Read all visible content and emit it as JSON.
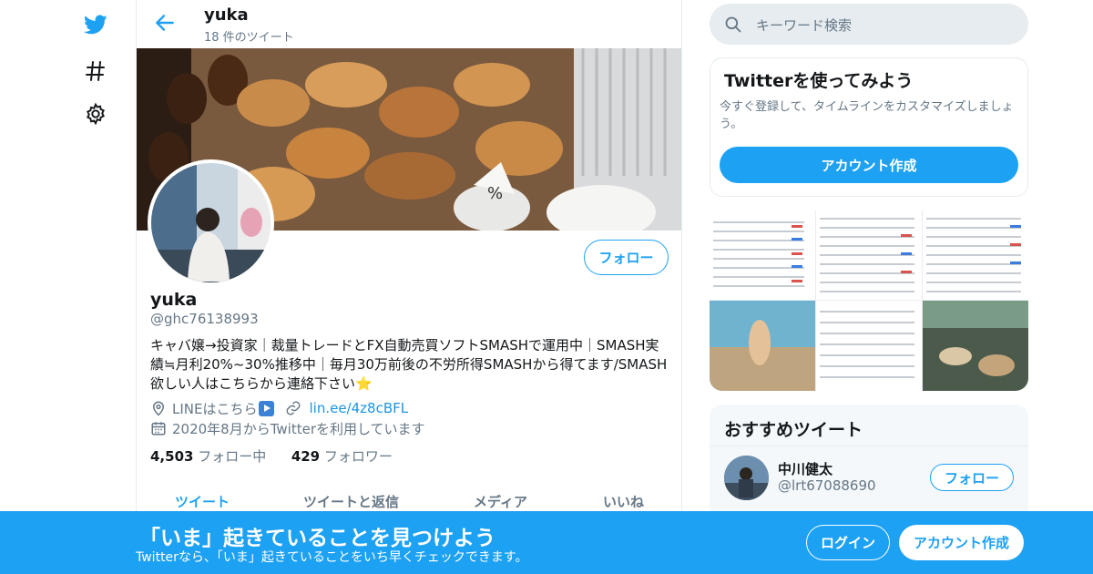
{
  "colors": {
    "accent": "#1da1f2",
    "secondary_text": "#657786",
    "border": "#e6ecf0"
  },
  "header": {
    "name": "yuka",
    "tweet_count": "18 件のツイート"
  },
  "profile": {
    "follow_label": "フォロー",
    "name": "yuka",
    "handle": "@ghc76138993",
    "bio": "キャバ嬢→投資家｜裁量トレードとFX自動売買ソフトSMASHで運用中｜SMASH実績≒月利20%~30%推移中｜毎月30万前後の不労所得SMASHから得てます/SMASH欲しい人はこちらから連絡下さい⭐",
    "location": "LINEはこちら",
    "link": "lin.ee/4z8cBFL",
    "joined": "2020年8月からTwitterを利用しています",
    "following_count": "4,503",
    "following_label": "フォロー中",
    "followers_count": "429",
    "followers_label": "フォロワー"
  },
  "tabs": [
    "ツイート",
    "ツイートと返信",
    "メディア",
    "いいね"
  ],
  "search": {
    "placeholder": "キーワード検索"
  },
  "signup_card": {
    "title": "Twitterを使ってみよう",
    "text": "今すぐ登録して、タイムラインをカスタマイズしましょう。",
    "button": "アカウント作成"
  },
  "recommend": {
    "title": "おすすめツイート",
    "user_name": "中川健太",
    "user_handle": "@lrt67088690",
    "follow_label": "フォロー"
  },
  "bottom_bar": {
    "title": "「いま」起きていることを見つけよう",
    "subtitle": "Twitterなら、「いま」起きていることをいち早くチェックできます。",
    "login": "ログイン",
    "signup": "アカウント作成"
  },
  "icons": [
    "twitter-bird-icon",
    "hashtag-icon",
    "gear-icon",
    "back-arrow-icon",
    "location-icon",
    "link-icon",
    "calendar-icon",
    "search-icon",
    "play-icon",
    "star-icon"
  ]
}
